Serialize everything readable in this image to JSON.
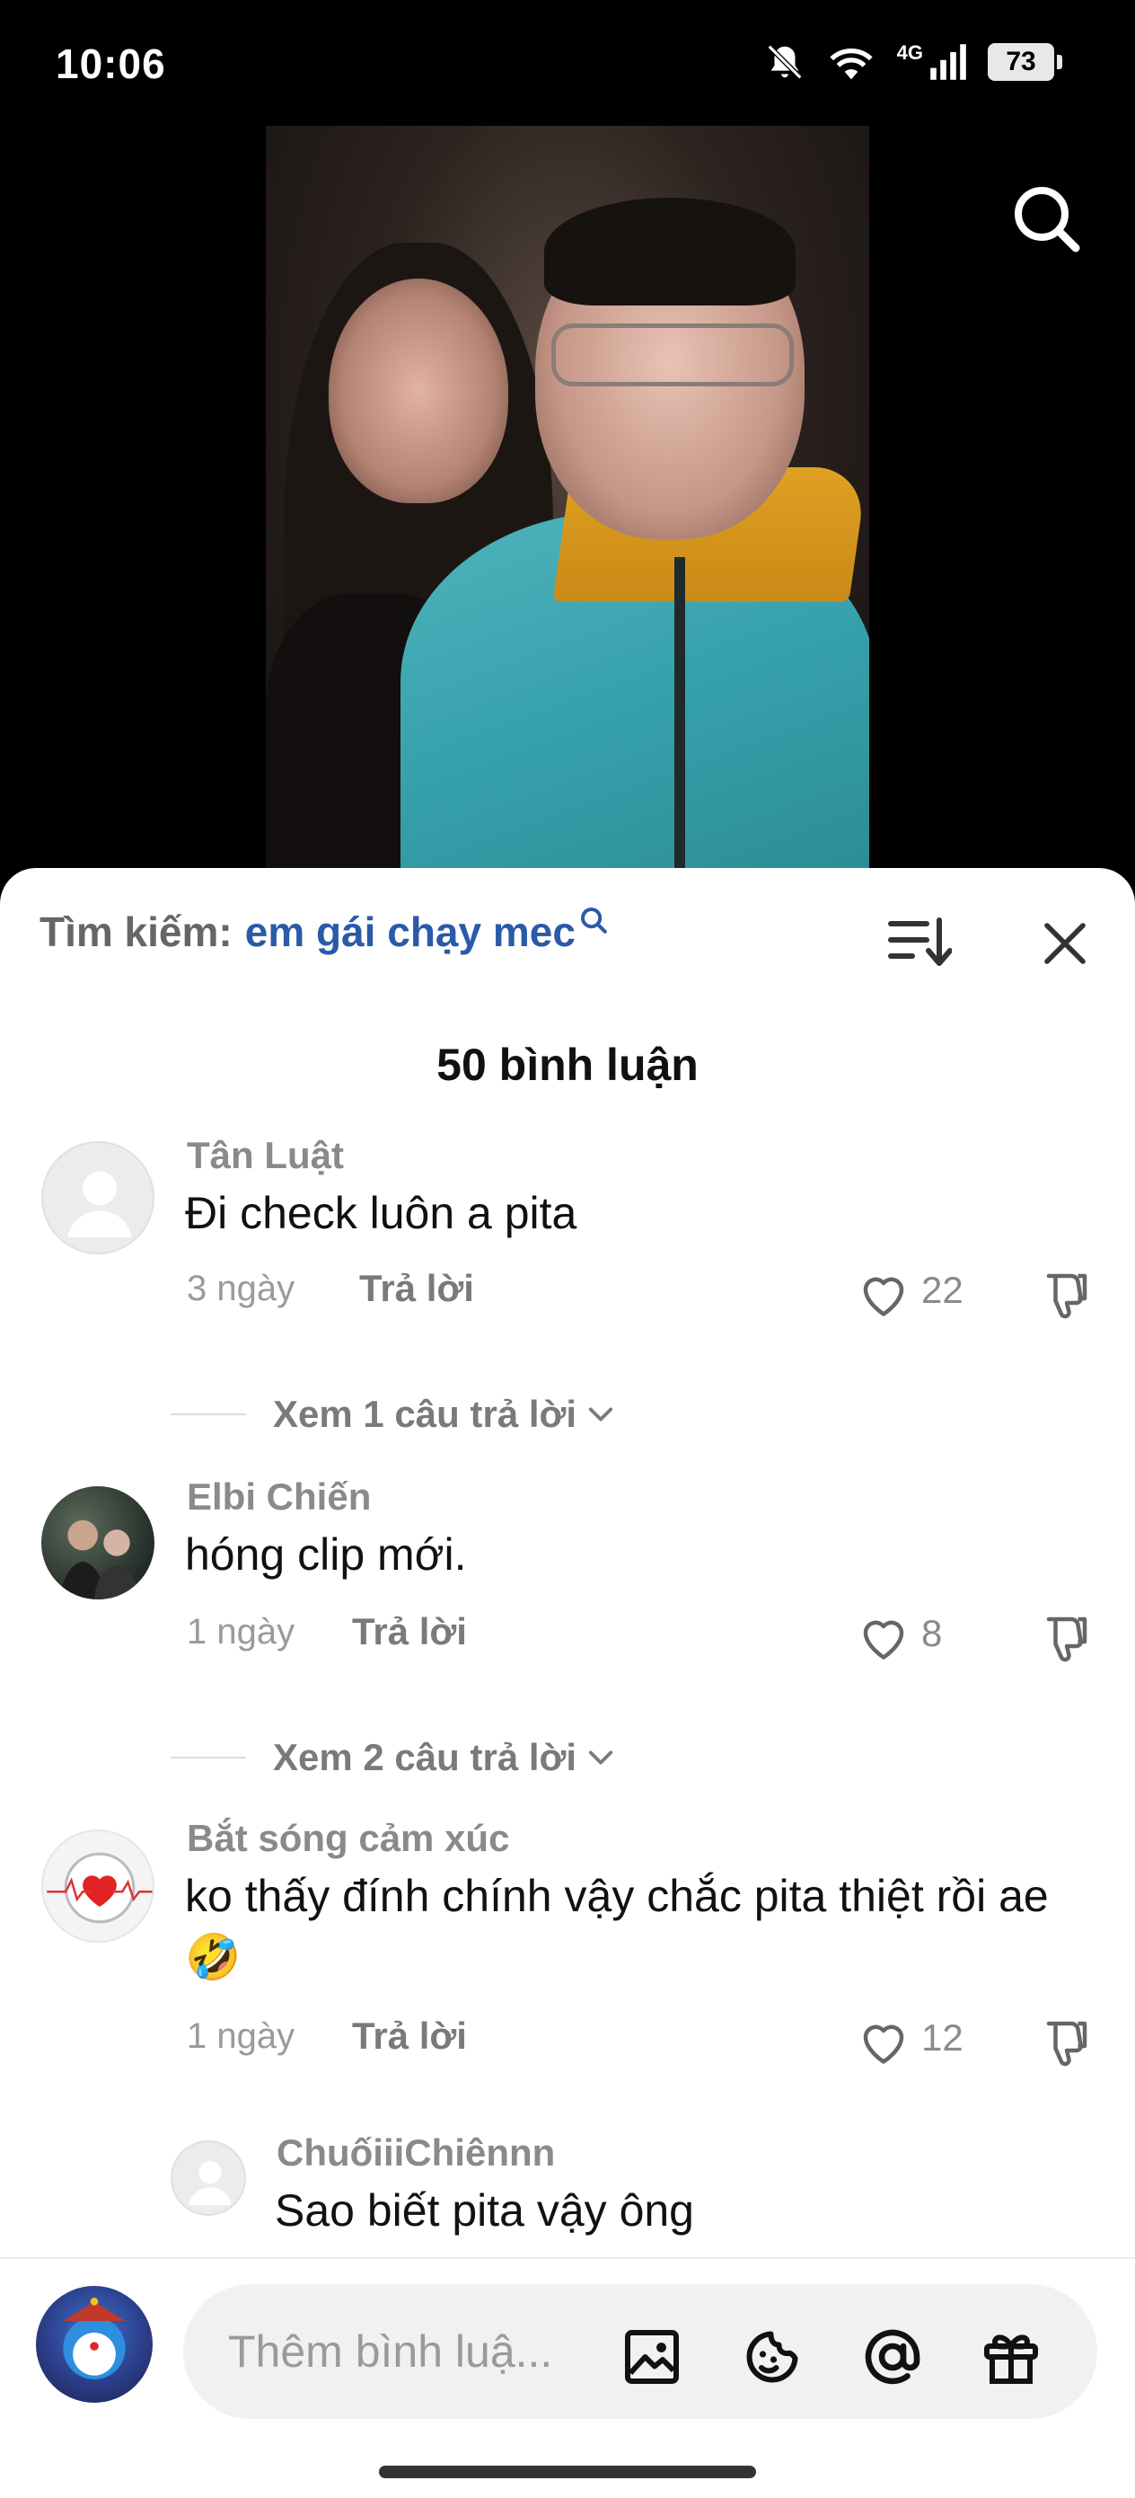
{
  "status_bar": {
    "time": "10:06",
    "network": "4G",
    "battery": "73"
  },
  "search": {
    "prefix": "Tìm kiếm:",
    "term": "em gái chạy mec"
  },
  "comments_header": {
    "count_label": "50 bình luận"
  },
  "comments": [
    {
      "name": "Tân Luật",
      "text": "Đi check luôn a pita",
      "time": "3 ngày",
      "reply_label": "Trả lời",
      "likes": "22",
      "view_replies": "Xem 1 câu trả lời"
    },
    {
      "name": "Elbi Chiến",
      "text": "hóng clip mới.",
      "time": "1 ngày",
      "reply_label": "Trả lời",
      "likes": "8",
      "view_replies": "Xem 2 câu trả lời"
    },
    {
      "name": "Bắt sóng cảm xúc",
      "text": "ko thấy đính chính vậy chắc pita thiệt rồi ae🤣",
      "time": "1 ngày",
      "reply_label": "Trả lời",
      "likes": "12"
    }
  ],
  "reply": {
    "name": "ChuốiiiChiênnn",
    "text": "Sao biết pita vậy ông"
  },
  "composer": {
    "placeholder": "Thêm bình luậ..."
  },
  "icons": [
    "bell-off-icon",
    "wifi-icon",
    "signal-icon",
    "battery-icon",
    "search-icon",
    "sort-icon",
    "close-icon",
    "heart-icon",
    "dislike-icon",
    "chevron-down-icon",
    "image-icon",
    "sticker-icon",
    "mention-icon",
    "gift-icon"
  ],
  "colors": {
    "search_term": "#2a5aa8",
    "sheet_bg": "#ffffff",
    "video_bg": "#000000"
  }
}
